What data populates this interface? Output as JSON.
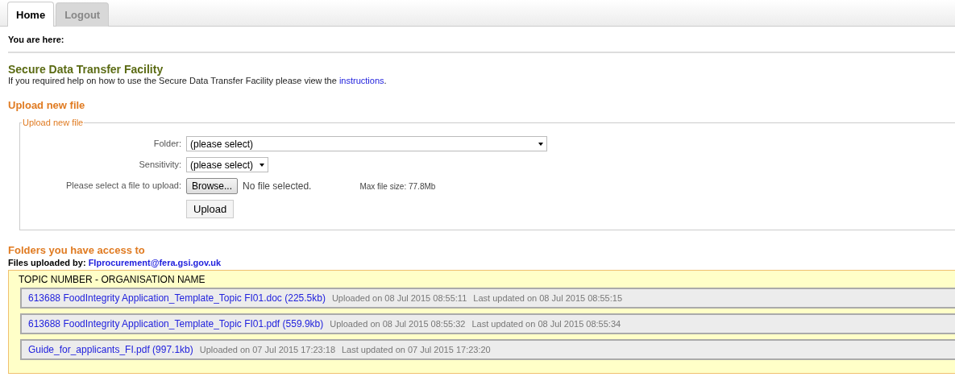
{
  "tabs": [
    {
      "label": "Home",
      "selected": true
    },
    {
      "label": "Logout",
      "selected": false
    }
  ],
  "breadcrumb": "You are here:",
  "page": {
    "title": "Secure Data Transfer Facility",
    "help_text": "If you required help on how to use the Secure Data Transfer Facility please view the ",
    "help_link": "instructions",
    "help_end": "."
  },
  "upload": {
    "heading": "Upload new file",
    "legend": "Upload new file",
    "folder": {
      "label": "Folder:",
      "value": "(please select)"
    },
    "sensitivity": {
      "label": "Sensitivity:",
      "value": "(please select)"
    },
    "file": {
      "label": "Please select a file to upload:",
      "browse": "Browse...",
      "status": "No file selected.",
      "max_size": "Max file size: 77.8Mb"
    },
    "submit": "Upload"
  },
  "folders": {
    "heading": "Folders you have access to",
    "uploaded_by_label": "Files uploaded by:",
    "uploaded_by": "FIprocurement@fera.gsi.gov.uk",
    "group_title": "TOPIC NUMBER - ORGANISATION NAME",
    "files": [
      {
        "name": "613688 FoodIntegrity Application_Template_Topic FI01.doc (225.5kb)",
        "uploaded": "Uploaded on 08 Jul 2015 08:55:11",
        "updated": "Last updated on 08 Jul 2015 08:55:15"
      },
      {
        "name": "613688 FoodIntegrity Application_Template_Topic FI01.pdf (559.9kb)",
        "uploaded": "Uploaded on 08 Jul 2015 08:55:32",
        "updated": "Last updated on 08 Jul 2015 08:55:34"
      },
      {
        "name": "Guide_for_applicants_FI.pdf (997.1kb)",
        "uploaded": "Uploaded on 07 Jul 2015 17:23:18",
        "updated": "Last updated on 07 Jul 2015 17:23:20"
      }
    ]
  }
}
